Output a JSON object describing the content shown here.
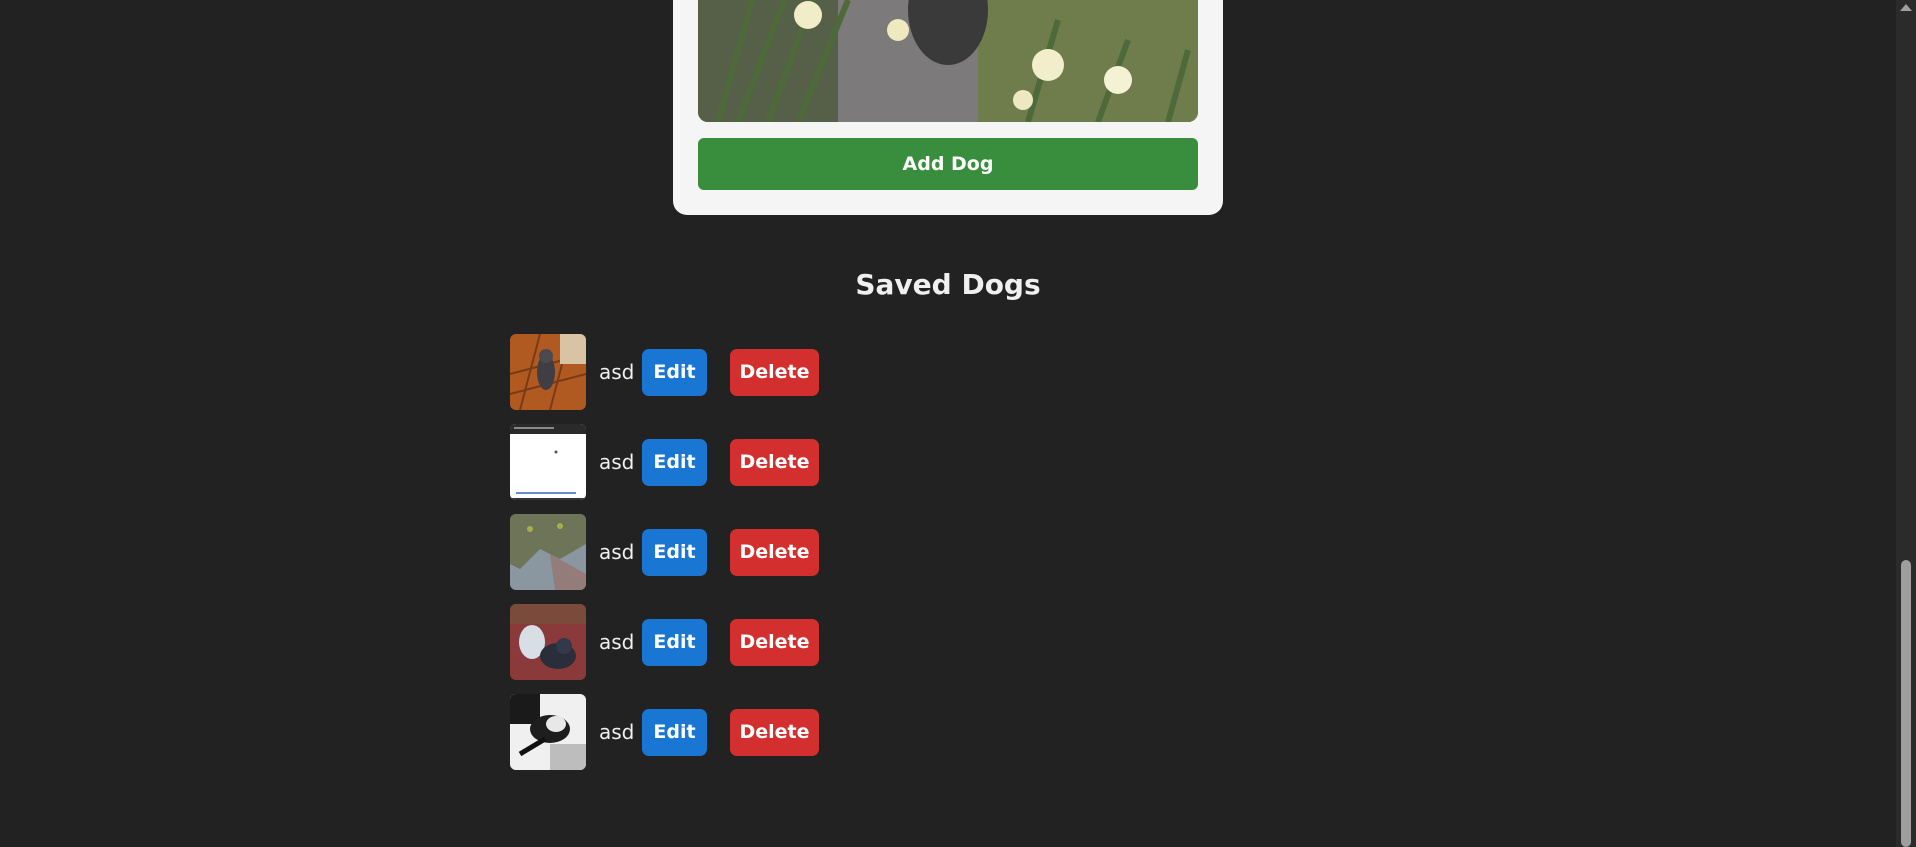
{
  "form": {
    "add_button_label": "Add Dog",
    "preview_image": "dog-with-daffodils-photo"
  },
  "saved": {
    "title": "Saved Dogs",
    "edit_label": "Edit",
    "delete_label": "Delete",
    "dogs": [
      {
        "name": "asd",
        "thumbnail": "dog-on-tile-floor-photo"
      },
      {
        "name": "asd",
        "thumbnail": "webpage-screenshot-image"
      },
      {
        "name": "asd",
        "thumbnail": "map-image"
      },
      {
        "name": "asd",
        "thumbnail": "two-dogs-on-couch-photo"
      },
      {
        "name": "asd",
        "thumbnail": "black-white-dog-photo"
      }
    ]
  },
  "colors": {
    "background": "#222222",
    "card": "#f5f5f5",
    "add": "#388e3c",
    "edit": "#1976d2",
    "delete": "#d32f2f"
  }
}
